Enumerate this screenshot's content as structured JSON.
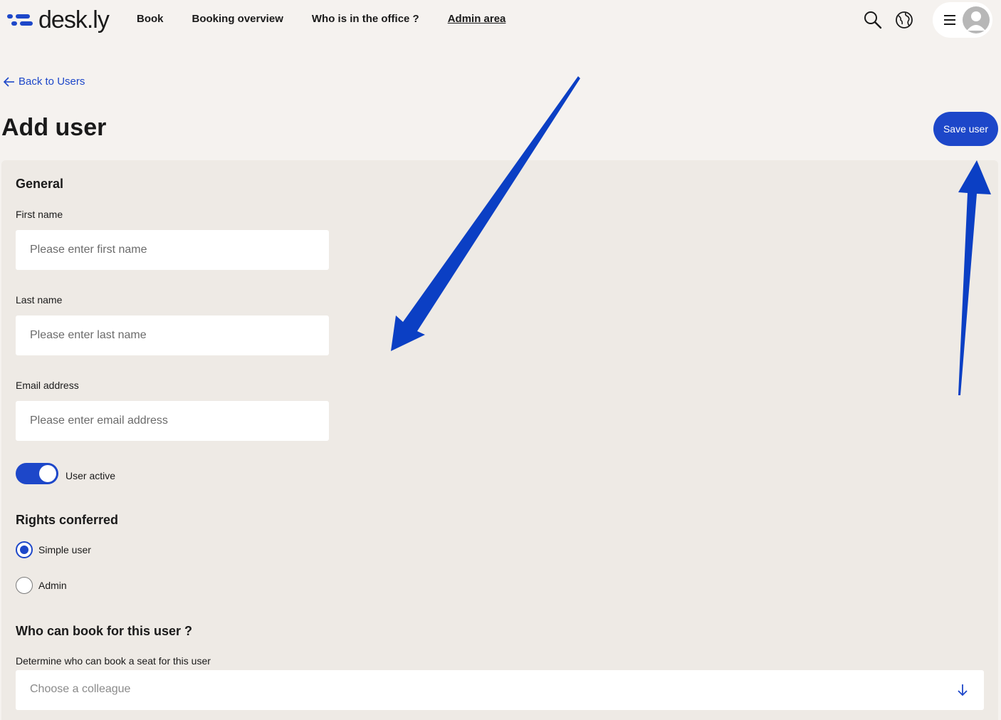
{
  "header": {
    "logo_text": "desk.ly",
    "nav": [
      {
        "label": "Book"
      },
      {
        "label": "Booking overview"
      },
      {
        "label": "Who is in the office ?"
      },
      {
        "label": "Admin area",
        "active": true
      }
    ],
    "icons": [
      "search-icon",
      "globe-icon",
      "hamburger-icon",
      "avatar-icon"
    ]
  },
  "page": {
    "back_label": "Back to Users",
    "title": "Add user",
    "save_label": "Save user"
  },
  "form": {
    "general_heading": "General",
    "first_name": {
      "label": "First name",
      "placeholder": "Please enter first name",
      "value": ""
    },
    "last_name": {
      "label": "Last name",
      "placeholder": "Please enter last name",
      "value": ""
    },
    "email": {
      "label": "Email address",
      "placeholder": "Please enter email address",
      "value": ""
    },
    "active_toggle": {
      "label": "User active",
      "on": true
    },
    "rights": {
      "heading": "Rights conferred",
      "options": [
        {
          "label": "Simple user",
          "checked": true
        },
        {
          "label": "Admin",
          "checked": false
        }
      ]
    },
    "booking": {
      "heading": "Who can book for this user ?",
      "description": "Determine who can book a seat for this user",
      "placeholder": "Choose a colleague"
    }
  },
  "colors": {
    "accent": "#1d47c9",
    "page_bg": "#f5f2ef",
    "card_bg": "#eeeae5",
    "annotation_arrow": "#0b3fc4"
  }
}
